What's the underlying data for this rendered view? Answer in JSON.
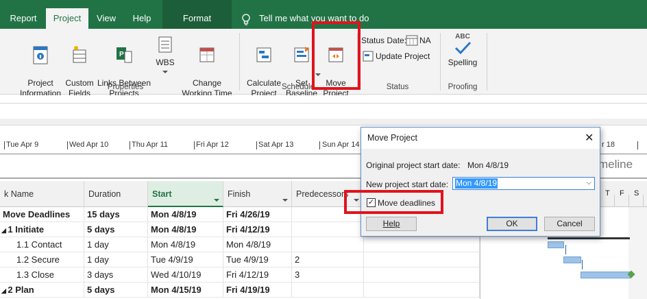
{
  "tabs": [
    {
      "label": "Report"
    },
    {
      "label": "Project"
    },
    {
      "label": "View"
    },
    {
      "label": "Help"
    },
    {
      "label": "Format"
    }
  ],
  "tell_me": "Tell me what you want to do",
  "ribbon": {
    "properties": {
      "project_info": "Project\nInformation",
      "custom_fields": "Custom\nFields",
      "links_between": "Links Between\nProjects",
      "wbs": "WBS",
      "change_working_time": "Change\nWorking Time",
      "label": "Properties"
    },
    "schedule": {
      "calculate": "Calculate\nProject",
      "set_baseline": "Set\nBaseline",
      "move_project": "Move\nProject",
      "label": "Schedule"
    },
    "status": {
      "status_date_label": "Status Date:",
      "status_date_value": "NA",
      "update_project": "Update Project",
      "label": "Status"
    },
    "proofing": {
      "spelling": "Spelling",
      "abc": "ABC",
      "label": "Proofing"
    }
  },
  "timeline": {
    "dates": [
      "Tue Apr 9",
      "Wed Apr 10",
      "Thu Apr 11",
      "Fri Apr 12",
      "Sat Apr 13",
      "Sun Apr 14",
      "r 18"
    ],
    "label": "meline"
  },
  "table": {
    "headers": {
      "name": "k Name",
      "duration": "Duration",
      "start": "Start",
      "finish": "Finish",
      "predecessors": "Predecessors"
    },
    "rows": [
      {
        "name": "Move Deadlines",
        "duration": "15 days",
        "start": "Mon 4/8/19",
        "finish": "Fri 4/26/19",
        "pred": ""
      },
      {
        "name": "1 Initiate",
        "duration": "5 days",
        "start": "Mon 4/8/19",
        "finish": "Fri 4/12/19",
        "pred": ""
      },
      {
        "name": "1.1 Contact",
        "duration": "1 day",
        "start": "Mon 4/8/19",
        "finish": "Mon 4/8/19",
        "pred": ""
      },
      {
        "name": "1.2 Secure",
        "duration": "1 day",
        "start": "Tue 4/9/19",
        "finish": "Tue 4/9/19",
        "pred": "2"
      },
      {
        "name": "1.3 Close",
        "duration": "3 days",
        "start": "Wed 4/10/19",
        "finish": "Fri 4/12/19",
        "pred": "3"
      },
      {
        "name": "2 Plan",
        "duration": "5 days",
        "start": "Mon 4/15/19",
        "finish": "Fri 4/19/19",
        "pred": ""
      }
    ]
  },
  "gantt": {
    "header_letters": [
      "T",
      "F",
      "S"
    ]
  },
  "dialog": {
    "title": "Move Project",
    "original_label": "Original project start date:",
    "original_value": "Mon 4/8/19",
    "new_label": "New project start date:",
    "new_value": "Mon 4/8/19",
    "checkbox_label": "Move deadlines",
    "help": "Help",
    "ok": "OK",
    "cancel": "Cancel"
  },
  "colors": {
    "accent": "#217346",
    "highlight": "#e1131d",
    "bar": "#9ec3e6"
  }
}
